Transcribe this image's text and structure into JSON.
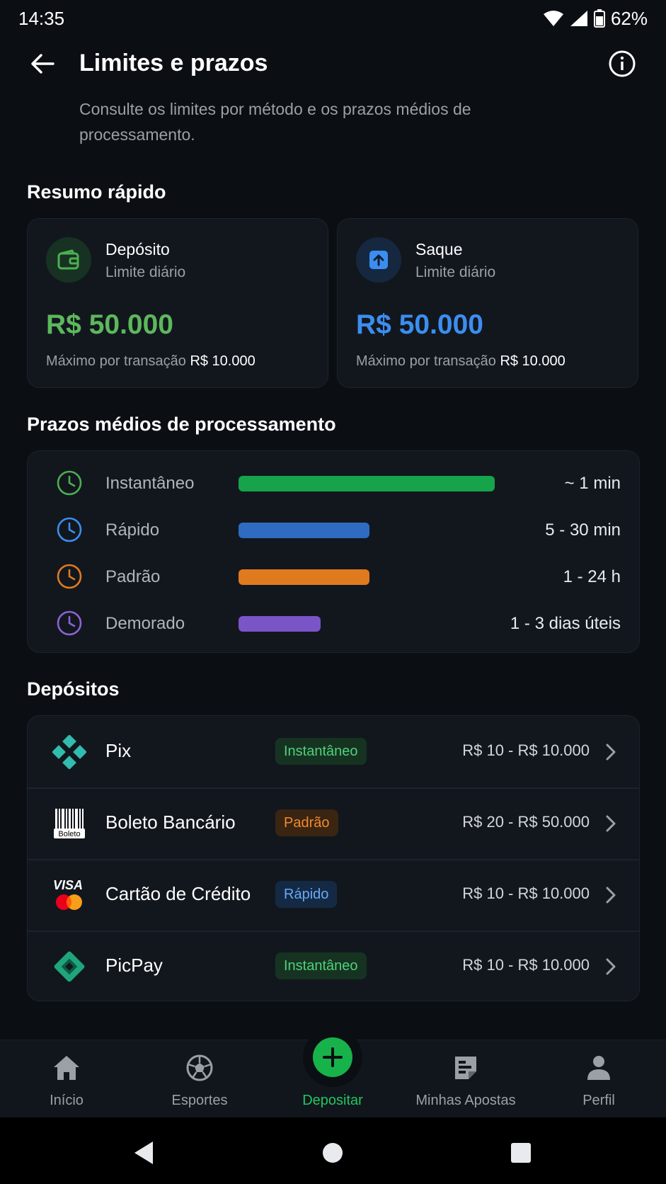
{
  "status_bar": {
    "time": "14:35",
    "battery": "62%"
  },
  "header": {
    "title": "Limites e prazos",
    "subtitle": "Consulte os limites por método e os prazos médios de processamento."
  },
  "summary": {
    "title": "Resumo rápido",
    "deposit": {
      "title": "Depósito",
      "sub": "Limite diário",
      "amount": "R$ 50.000",
      "max_label": "Máximo por transação",
      "max_value": "R$ 10.000",
      "color": "#4caf50"
    },
    "withdraw": {
      "title": "Saque",
      "sub": "Limite diário",
      "amount": "R$ 50.000",
      "max_label": "Máximo por transação",
      "max_value": "R$ 10.000",
      "color": "#3b8ef0"
    }
  },
  "processing": {
    "title": "Prazos médios de processamento",
    "rows": [
      {
        "label": "Instantâneo",
        "value": "~ 1 min",
        "color": "#16a34a",
        "fill": 1.0
      },
      {
        "label": "Rápido",
        "value": "5 - 30 min",
        "color": "#2f6cc1",
        "fill": 0.51
      },
      {
        "label": "Padrão",
        "value": "1 - 24 h",
        "color": "#e07a1f",
        "fill": 0.51
      },
      {
        "label": "Demorado",
        "value": "1 - 3 dias úteis",
        "color": "#7a55c7",
        "fill": 0.32
      }
    ]
  },
  "deposits": {
    "title": "Depósitos",
    "items": [
      {
        "name": "Pix",
        "badge": "Instantâneo",
        "range": "R$ 10 - R$ 10.000"
      },
      {
        "name": "Boleto Bancário",
        "badge": "Padrão",
        "range": "R$ 20 - R$ 50.000",
        "icon_text": "Boleto"
      },
      {
        "name": "Cartão de Crédito",
        "badge": "Rápido",
        "range": "R$ 10 - R$ 10.000",
        "icon_text": "VISA"
      },
      {
        "name": "PicPay",
        "badge": "Instantâneo",
        "range": "R$ 10 - R$ 10.000"
      }
    ]
  },
  "nav": {
    "items": [
      "Início",
      "Esportes",
      "Depositar",
      "Minhas Apostas",
      "Perfil"
    ],
    "active": "Depositar",
    "accent": "#22c55e"
  }
}
